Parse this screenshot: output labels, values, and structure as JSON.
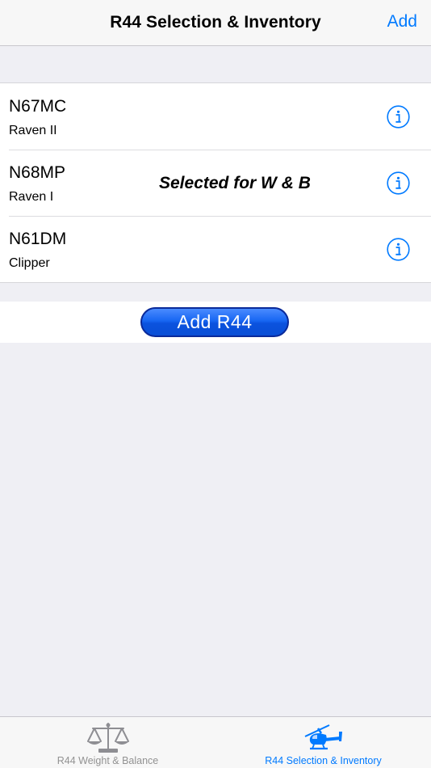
{
  "navbar": {
    "title": "R44 Selection & Inventory",
    "add_label": "Add"
  },
  "aircraft": [
    {
      "registration": "N67MC",
      "model": "Raven II",
      "selected_label": ""
    },
    {
      "registration": "N68MP",
      "model": "Raven I",
      "selected_label": "Selected for W & B"
    },
    {
      "registration": "N61DM",
      "model": "Clipper",
      "selected_label": ""
    }
  ],
  "add_button_label": "Add R44",
  "tabbar": {
    "tabs": [
      {
        "label": "R44 Weight & Balance",
        "icon": "balance-scale-icon",
        "active": false
      },
      {
        "label": "R44 Selection & Inventory",
        "icon": "helicopter-icon",
        "active": true
      }
    ]
  },
  "colors": {
    "accent": "#007aff",
    "add_button": "#1766f2",
    "inactive_tab": "#929292"
  }
}
